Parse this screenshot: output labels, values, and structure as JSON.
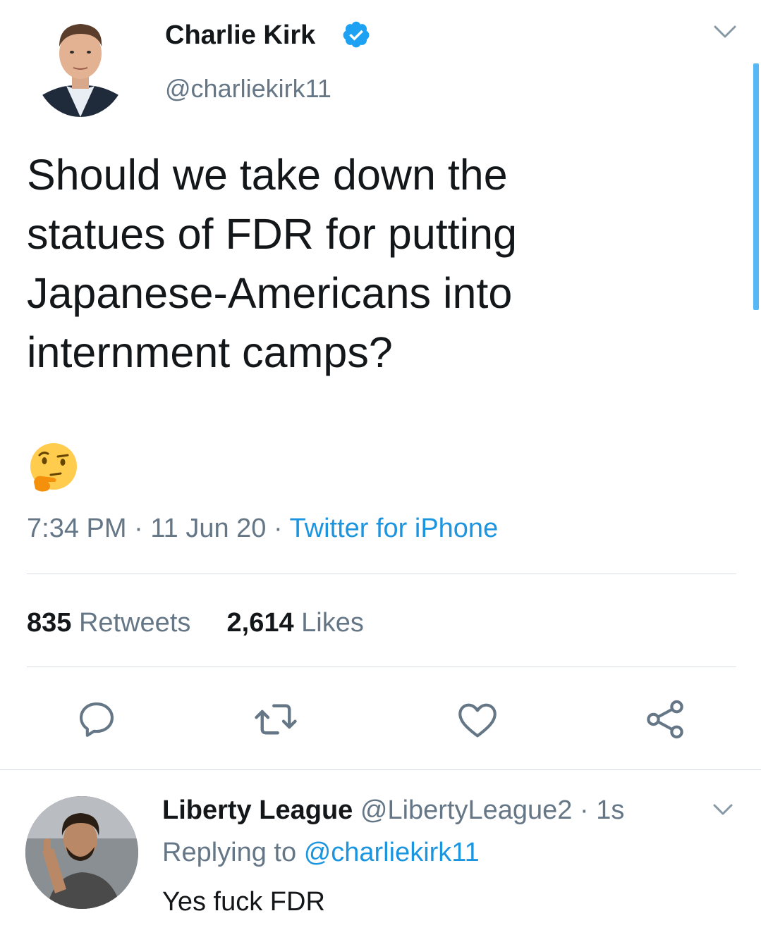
{
  "tweet": {
    "author_name": "Charlie Kirk",
    "author_handle": "@charliekirk11",
    "verified": true,
    "text_lines": [
      "Should we take down the",
      "statues of FDR for putting",
      "Japanese-Americans into",
      "internment camps?"
    ],
    "emoji": "thinking-face",
    "time": "7:34 PM",
    "separator": "·",
    "date": "11 Jun 20",
    "source": "Twitter for iPhone",
    "retweets_count": "835",
    "retweets_label": "Retweets",
    "likes_count": "2,614",
    "likes_label": "Likes"
  },
  "actions": [
    {
      "name": "reply-icon"
    },
    {
      "name": "retweet-icon"
    },
    {
      "name": "like-icon"
    },
    {
      "name": "share-icon"
    }
  ],
  "reply": {
    "author_name": "Liberty League",
    "author_handle": "@LibertyLeague2",
    "separator": "·",
    "time": "1s",
    "replying_prefix": "Replying to",
    "replying_to": "@charliekirk11",
    "text": "Yes fuck FDR"
  },
  "colors": {
    "primary_text": "#14171a",
    "secondary_text": "#657786",
    "link_blue": "#1b95e0",
    "verified_blue": "#1da1f2",
    "divider": "#d8dee3"
  }
}
